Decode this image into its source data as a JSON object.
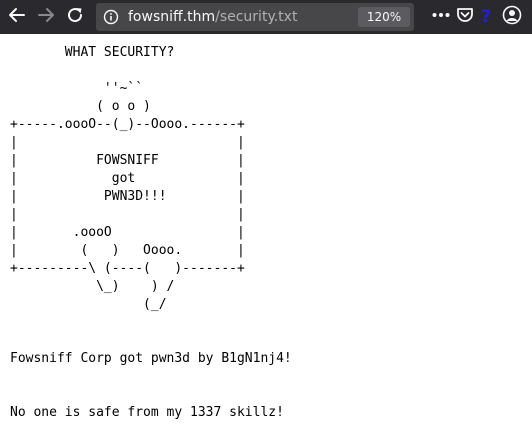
{
  "browser": {
    "url_host": "fowsniff.thm",
    "url_path": "/security.txt",
    "zoom": "120%",
    "icons": {
      "back": "arrow-left-icon",
      "forward": "arrow-right-icon",
      "reload": "reload-icon",
      "site_info": "info-icon",
      "menu": "more-dots-icon",
      "pocket": "pocket-icon",
      "extension": "help-question-icon",
      "extension_glyph": "?",
      "account": "user-icon"
    },
    "colors": {
      "toolbar": "#2a2a2e",
      "urlbar": "#474749",
      "extension_icon": "#1f1fd6"
    }
  },
  "page": {
    "lines": [
      "       WHAT SECURITY?",
      "",
      "            ''~``",
      "           ( o o )",
      "+-----.oooO--(_)--Oooo.------+",
      "|                            |",
      "|          FOWSNIFF          |",
      "|            got             |",
      "|           PWN3D!!!         |",
      "|                            |",
      "|       .oooO                |",
      "|        (   )   Oooo.       |",
      "+---------\\ (----(   )-------+",
      "           \\_)    ) /",
      "                 (_/",
      "",
      "",
      "Fowsniff Corp got pwn3d by B1gN1nj4!",
      "",
      "",
      "No one is safe from my 1337 skillz!"
    ]
  }
}
